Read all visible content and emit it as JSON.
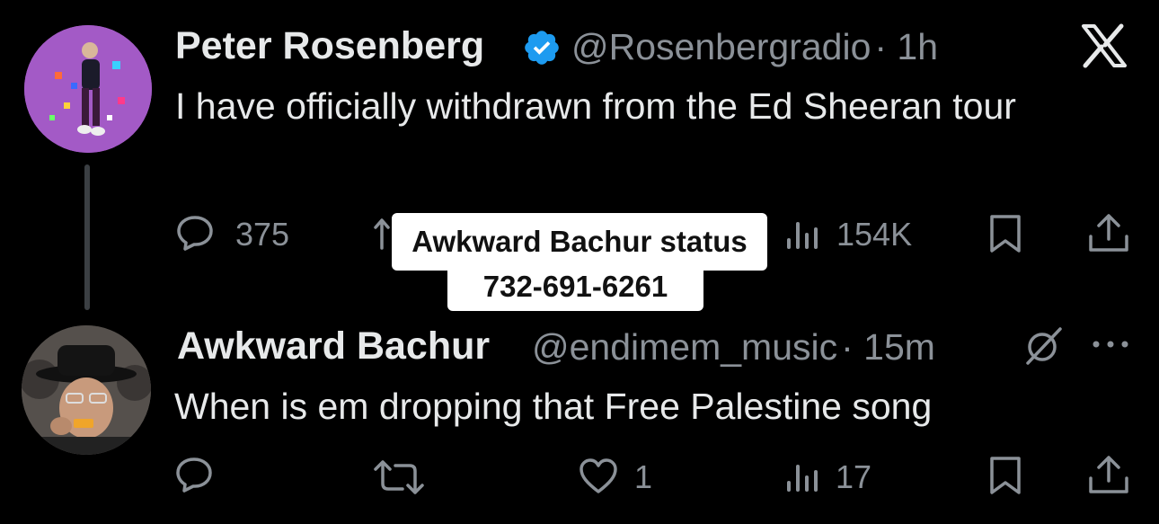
{
  "tweet1": {
    "name": "Peter Rosenberg",
    "handle": "@Rosenbergradio",
    "time": "· 1h",
    "text": "I have officially withdrawn from the Ed Sheeran tour",
    "replies": "375",
    "views": "154K"
  },
  "tweet2": {
    "name": "Awkward Bachur",
    "handle": "@endimem_music",
    "time": "· 15m",
    "text": "When is em dropping that Free Palestine song",
    "likes": "1",
    "views": "17"
  },
  "overlay": {
    "line1": "Awkward Bachur status",
    "line2": "732-691-6261"
  },
  "icons": {
    "logo": "x-logo-icon",
    "verified": "verified-badge-icon",
    "reply": "reply-icon",
    "retweet": "retweet-icon",
    "like": "heart-icon",
    "views": "views-icon",
    "bookmark": "bookmark-icon",
    "share": "share-icon",
    "grok": "grok-icon",
    "more": "more-icon"
  },
  "colors": {
    "background": "#000000",
    "text": "#e7e9ea",
    "secondary": "#8b9198",
    "verified": "#1d9bf0",
    "avatar1": "#a35ac6"
  }
}
